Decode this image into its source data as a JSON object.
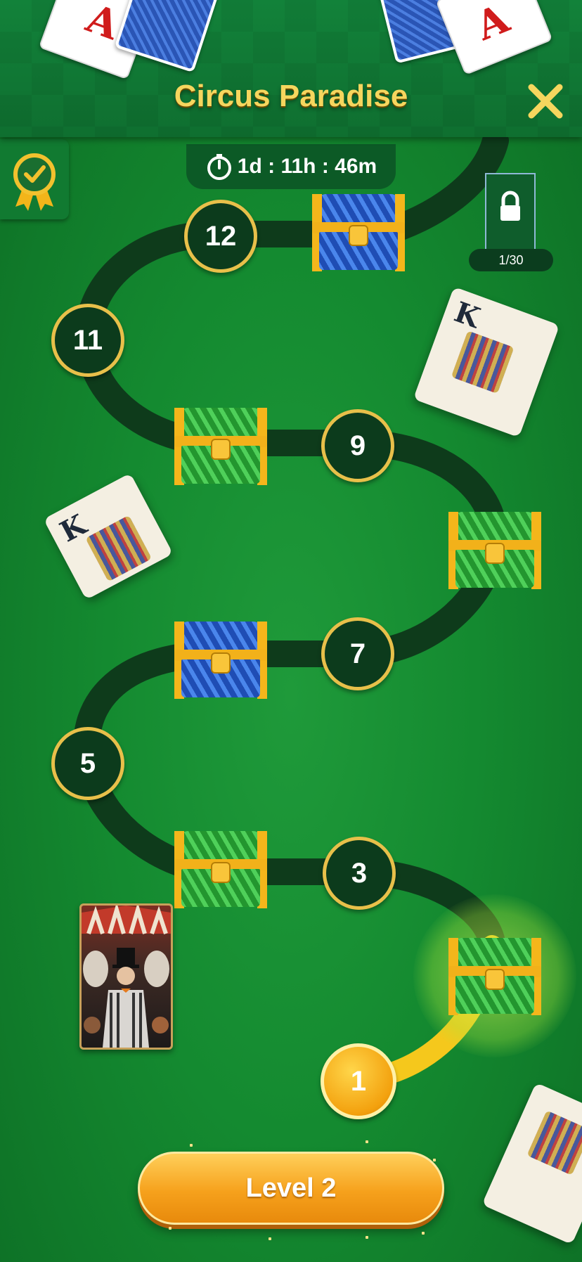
{
  "header": {
    "title": "Circus Paradise",
    "card_left_rank": "A",
    "card_right_rank": "A"
  },
  "timer": {
    "text": "1d : 11h : 46m",
    "icon": "stopwatch-icon"
  },
  "badge": {
    "icon": "check-ribbon-icon"
  },
  "lock_panel": {
    "icon": "padlock-icon",
    "progress": "1/30"
  },
  "levels": [
    {
      "label": "1",
      "state": "current"
    },
    {
      "label": "3"
    },
    {
      "label": "5"
    },
    {
      "label": "7"
    },
    {
      "label": "9"
    },
    {
      "label": "11"
    },
    {
      "label": "12"
    }
  ],
  "chests": [
    "green",
    "green",
    "blue",
    "green",
    "green",
    "blue"
  ],
  "flying_cards": [
    {
      "rank": "K"
    },
    {
      "rank": "K"
    }
  ],
  "level_button": {
    "label": "Level 2"
  },
  "colors": {
    "accent": "#f6d65e",
    "button": "#f6a11c",
    "node": "#0c3b1c"
  }
}
